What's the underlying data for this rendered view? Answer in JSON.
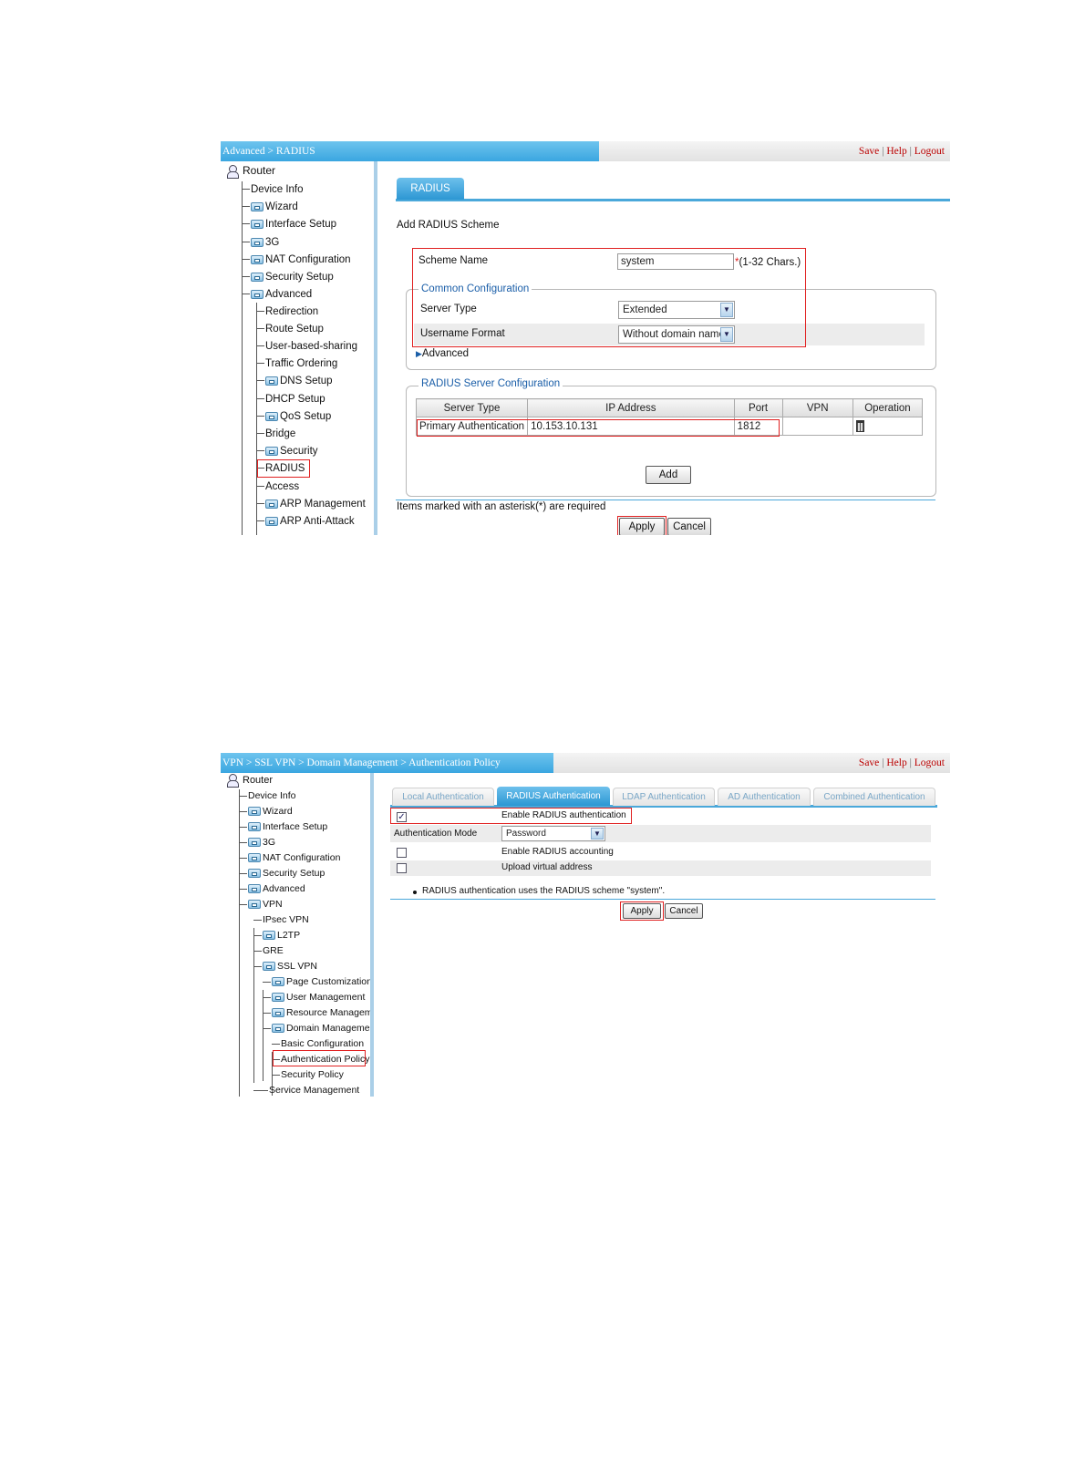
{
  "screen1": {
    "breadcrumb": "Advanced > RADIUS",
    "top_links": {
      "save": "Save",
      "help": "Help",
      "logout": "Logout",
      "separator": "|"
    },
    "nav": {
      "root": "Router",
      "items": [
        "Device Info",
        "Wizard",
        "Interface Setup",
        "3G",
        "NAT Configuration",
        "Security Setup",
        "Advanced"
      ],
      "sub_items": [
        "Redirection",
        "Route Setup",
        "User-based-sharing",
        "Traffic Ordering",
        "DNS Setup",
        "DHCP Setup",
        "QoS Setup",
        "Bridge",
        "Security",
        "RADIUS",
        "Access",
        "ARP Management",
        "ARP Anti-Attack"
      ]
    },
    "tab": "RADIUS",
    "heading": "Add RADIUS Scheme",
    "scheme_name_label": "Scheme Name",
    "scheme_name_value": "system",
    "required_mark": "*",
    "scheme_name_hint": "(1-32 Chars.)",
    "common_config_legend": "Common Configuration",
    "server_type_label": "Server Type",
    "server_type_value": "Extended",
    "username_format_label": "Username Format",
    "username_format_value": "Without domain name",
    "advanced_link": "Advanced",
    "server_config_legend": "RADIUS Server Configuration",
    "table": {
      "headers": [
        "Server Type",
        "IP Address",
        "Port",
        "VPN",
        "Operation"
      ],
      "rows": [
        [
          "Primary Authentication",
          "10.153.10.131",
          "1812",
          ""
        ]
      ]
    },
    "add_button": "Add",
    "required_note": "Items marked with an asterisk(*) are required",
    "apply_button": "Apply",
    "cancel_button": "Cancel"
  },
  "screen2": {
    "breadcrumb": "VPN > SSL VPN > Domain Management > Authentication Policy",
    "top_links": {
      "save": "Save",
      "help": "Help",
      "logout": "Logout",
      "separator": "|"
    },
    "nav": {
      "root": "Router",
      "items": [
        "Device Info",
        "Wizard",
        "Interface Setup",
        "3G",
        "NAT Configuration",
        "Security Setup",
        "Advanced",
        "VPN"
      ],
      "vpn_items": [
        "IPsec VPN",
        "L2TP",
        "GRE",
        "SSL VPN"
      ],
      "ssl_items": [
        "Page Customization",
        "User Management",
        "Resource Management",
        "Domain Management"
      ],
      "domain_items": [
        "Basic Configuration",
        "Authentication Policy",
        "Security Policy"
      ],
      "last_item": "Service Management"
    },
    "tabs": [
      "Local Authentication",
      "RADIUS Authentication",
      "LDAP Authentication",
      "AD Authentication",
      "Combined Authentication"
    ],
    "enable_radius_auth": "Enable RADIUS authentication",
    "auth_mode_label": "Authentication Mode",
    "auth_mode_value": "Password",
    "enable_radius_acct": "Enable RADIUS accounting",
    "upload_virtual": "Upload virtual address",
    "note": "RADIUS authentication uses the RADIUS scheme \"system\".",
    "apply_button": "Apply",
    "cancel_button": "Cancel"
  },
  "colors": {
    "accent": "#3aa6e0",
    "highlight": "#e02020",
    "link": "#b00000"
  }
}
